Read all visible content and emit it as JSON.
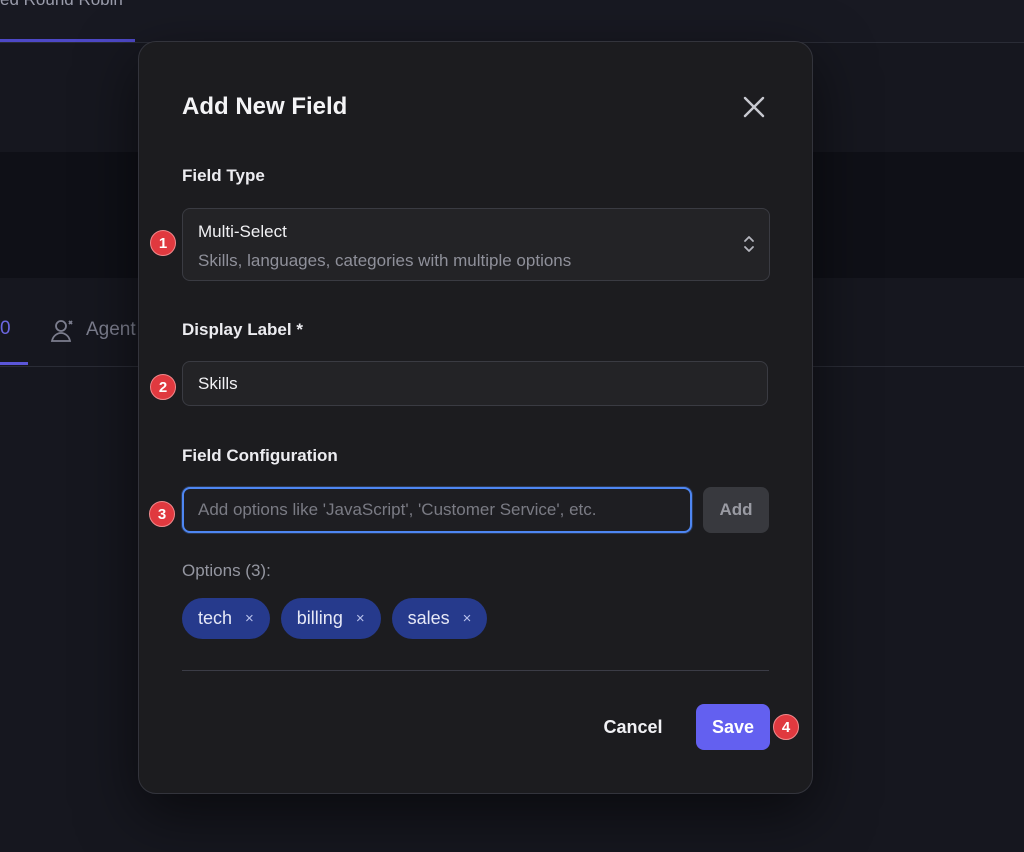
{
  "background": {
    "top_tab_label": "ed Round Robin",
    "tab_partial_label": "0",
    "agent_tab_label": "Agent",
    "accent_color": "#5b56d8"
  },
  "modal": {
    "title": "Add New Field",
    "close_icon": "close-icon",
    "field_type": {
      "label": "Field Type",
      "value": "Multi-Select",
      "description": "Skills, languages, categories with multiple options"
    },
    "display_label": {
      "label": "Display Label *",
      "value": "Skills"
    },
    "field_configuration": {
      "label": "Field Configuration",
      "input_value": "",
      "placeholder": "Add options like 'JavaScript', 'Customer Service', etc.",
      "add_label": "Add"
    },
    "options": {
      "count_label": "Options (3):",
      "items": [
        {
          "label": "tech",
          "remove": "×"
        },
        {
          "label": "billing",
          "remove": "×"
        },
        {
          "label": "sales",
          "remove": "×"
        }
      ],
      "chip_color": "#263a8c"
    },
    "cancel_label": "Cancel",
    "save_label": "Save",
    "save_color": "#6360f0"
  },
  "markers": [
    "1",
    "2",
    "3",
    "4"
  ],
  "marker_color": "#e0393f"
}
